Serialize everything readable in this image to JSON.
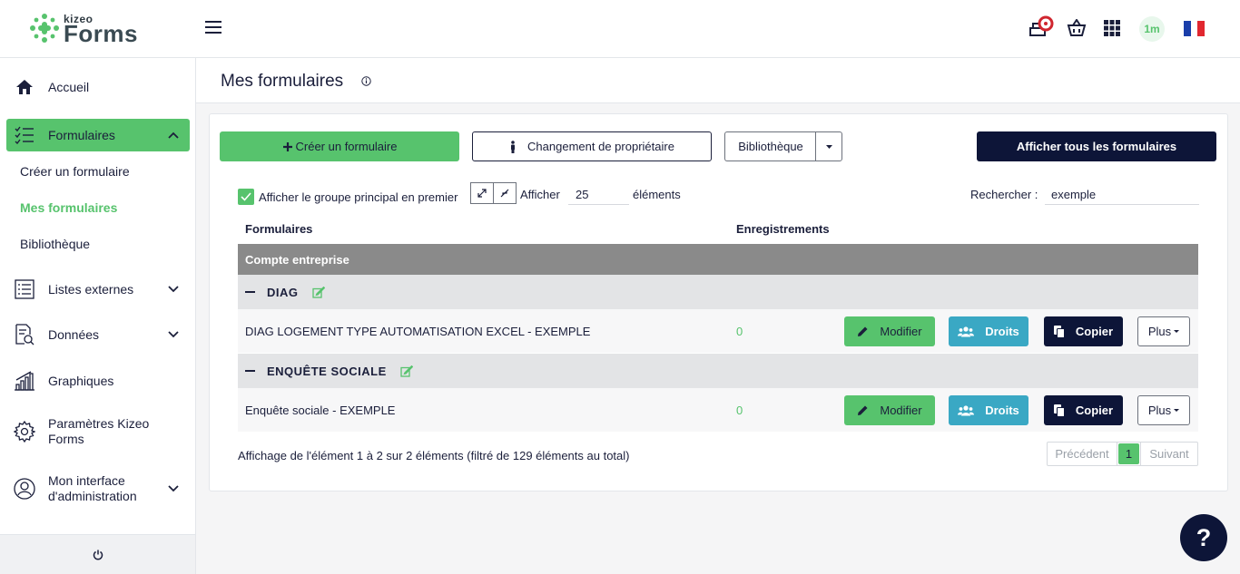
{
  "header": {
    "logo_top": "kizeo",
    "logo_main": "Forms",
    "user_badge": "1m",
    "flag_colors": [
      "#1a3eaa",
      "#ffffff",
      "#e1272f"
    ]
  },
  "sidebar": {
    "items": [
      {
        "label": "Accueil",
        "icon": "home-icon"
      },
      {
        "label": "Formulaires",
        "icon": "list-check-icon"
      },
      {
        "label": "Listes externes",
        "icon": "list-icon"
      },
      {
        "label": "Données",
        "icon": "document-search-icon"
      },
      {
        "label": "Graphiques",
        "icon": "bar-chart-icon"
      },
      {
        "label": "Paramètres Kizeo Forms",
        "icon": "gear-icon"
      },
      {
        "label": "Mon interface d'administration",
        "icon": "user-circle-icon"
      }
    ],
    "subitems": [
      "Créer un formulaire",
      "Mes formulaires",
      "Bibliothèque"
    ]
  },
  "page": {
    "title": "Mes formulaires"
  },
  "toolbar": {
    "create_label": "Créer un formulaire",
    "owner_change_label": "Changement de propriétaire",
    "library_label": "Bibliothèque",
    "show_all_label": "Afficher tous les formulaires"
  },
  "filters": {
    "checkbox_label": "Afficher le groupe principal en premier",
    "show_label": "Afficher",
    "length_value": "25",
    "elements_label": "éléments",
    "search_label": "Rechercher :",
    "search_value": "exemple"
  },
  "table": {
    "headers": [
      "Formulaires",
      "Enregistrements"
    ],
    "group": "Compte entreprise",
    "subgroups": [
      {
        "name": "DIAG",
        "row": {
          "name": "DIAG LOGEMENT TYPE AUTOMATISATION EXCEL - EXEMPLE",
          "count": "0"
        }
      },
      {
        "name": "ENQUÊTE SOCIALE",
        "row": {
          "name": "Enquête sociale - EXEMPLE",
          "count": "0"
        }
      }
    ],
    "actions": {
      "modify": "Modifier",
      "rights": "Droits",
      "copy": "Copier",
      "more": "Plus"
    }
  },
  "footer": {
    "info": "Affichage de l'élément 1 à 2 sur 2 éléments (filtré de 129 éléments au total)",
    "prev": "Précédent",
    "page": "1",
    "next": "Suivant"
  },
  "help": "?",
  "colors": {
    "accent": "#57c36d",
    "dark": "#0d1538",
    "teal": "#3aa8c4"
  }
}
